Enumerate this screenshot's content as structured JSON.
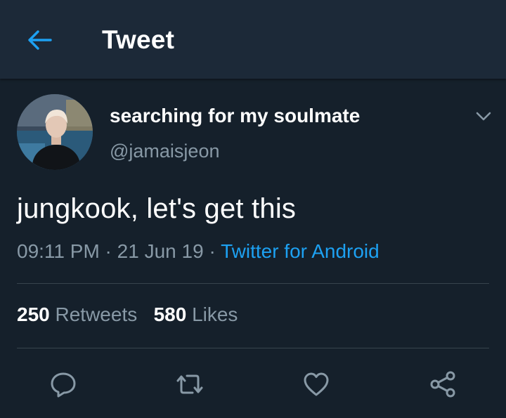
{
  "header": {
    "title": "Tweet",
    "back_icon": "arrow-left-icon"
  },
  "tweet": {
    "author": {
      "name": "searching for my soulmate",
      "handle": "@jamaisjeon"
    },
    "text": "jungkook, let's get this",
    "time": "09:11 PM",
    "date": "21 Jun 19",
    "separator": " · ",
    "source": "Twitter for Android",
    "retweets": {
      "count": "250",
      "label": "Retweets"
    },
    "likes": {
      "count": "580",
      "label": "Likes"
    },
    "actions": [
      "reply-icon",
      "retweet-icon",
      "like-icon",
      "share-icon"
    ]
  },
  "colors": {
    "background": "#15202b",
    "header": "#1c2938",
    "accent": "#1da1f2",
    "secondary_text": "#8899a6",
    "divider": "#38444d"
  }
}
